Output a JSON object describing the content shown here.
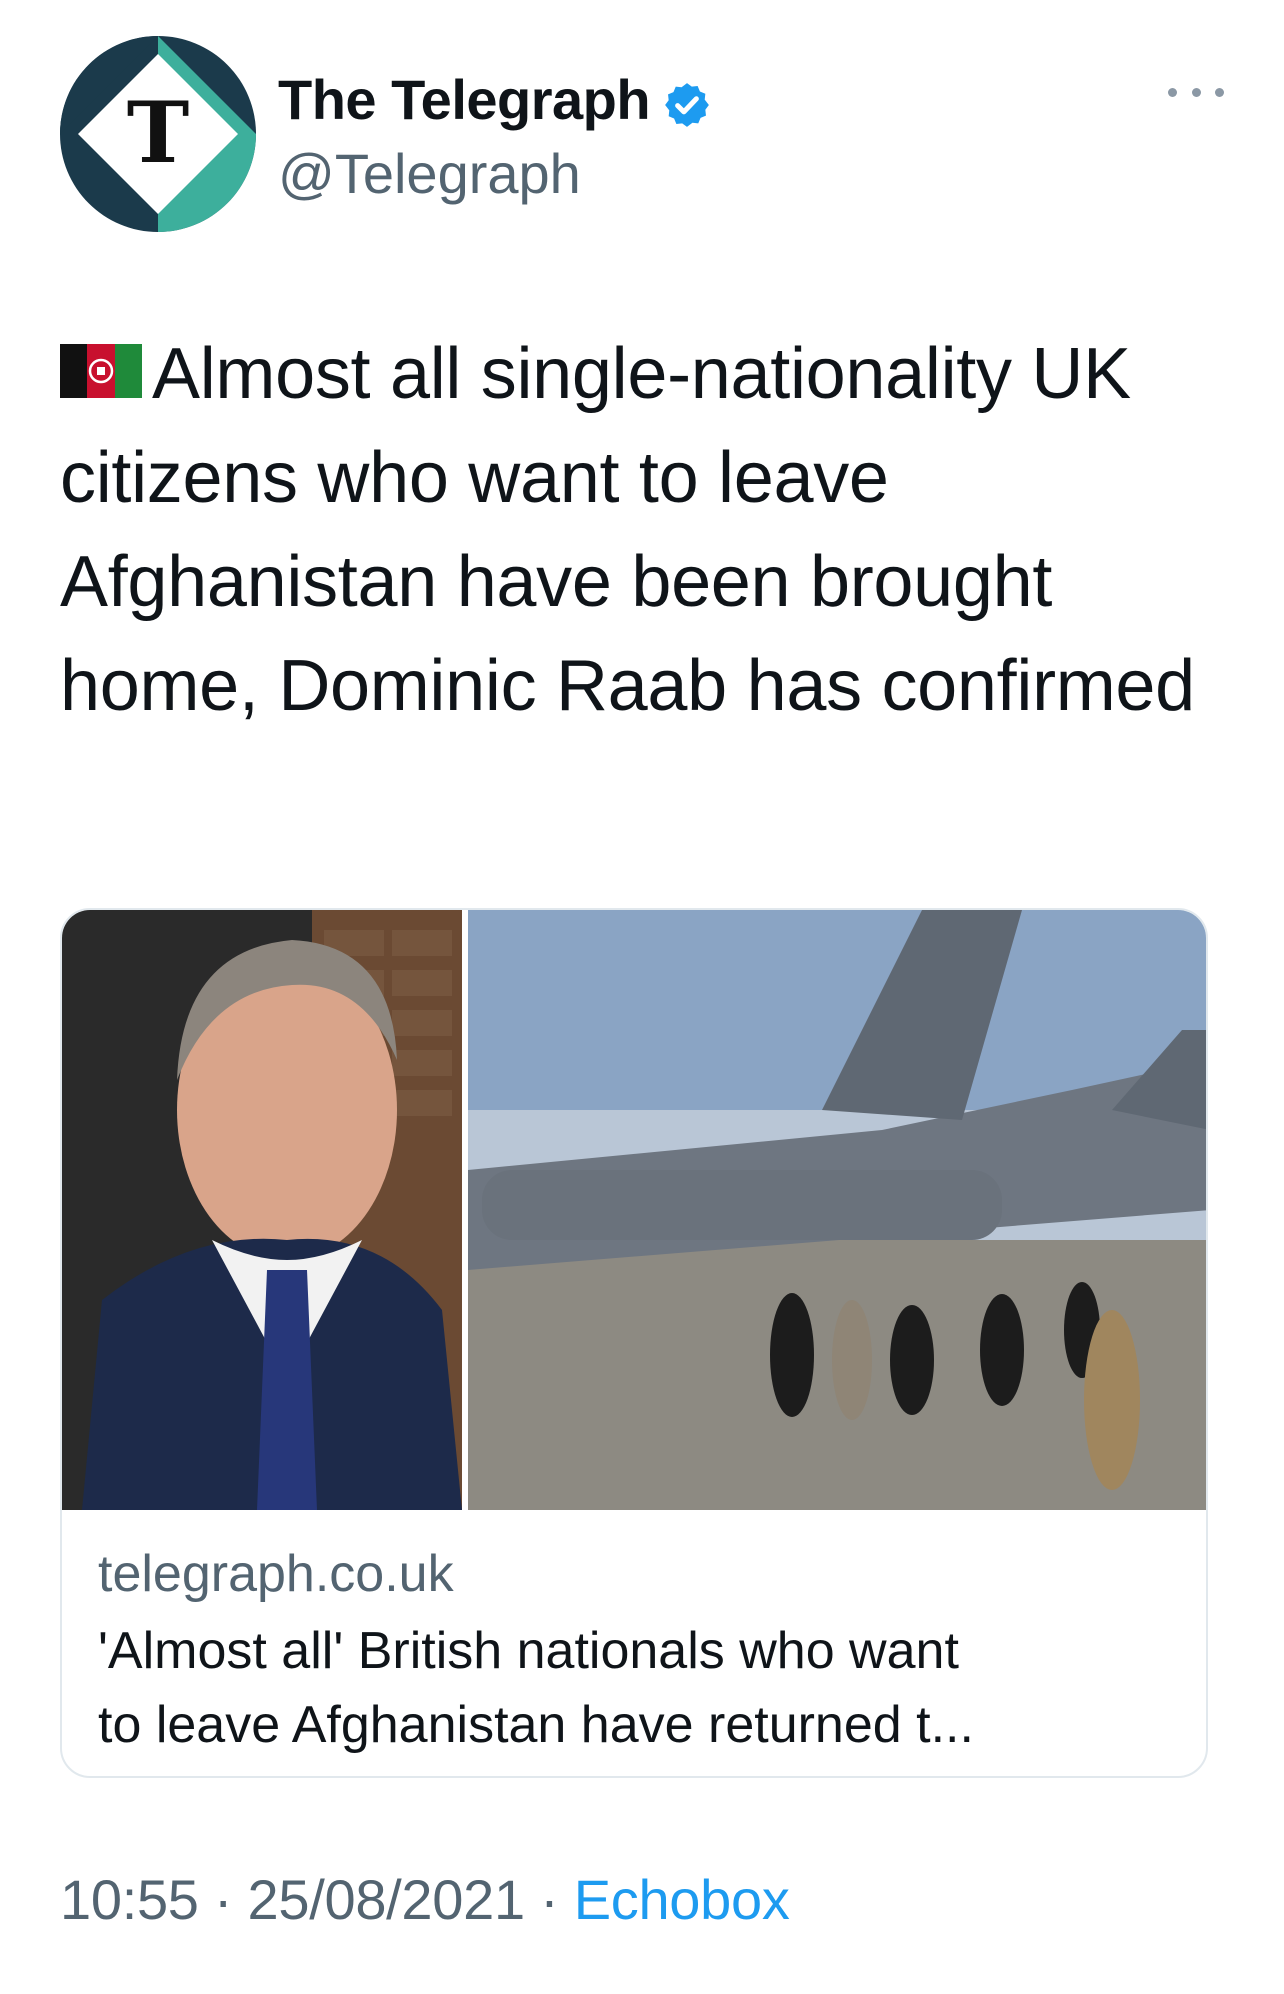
{
  "tweet": {
    "author": {
      "display_name": "The Telegraph",
      "handle": "@Telegraph",
      "verified": true,
      "avatar_letter": "T"
    },
    "flag_icon": "afghanistan-flag-emoji",
    "text": "Almost all single-nationality UK citizens who want to leave Afghanistan have been brought home, Dominic Raab has confirmed",
    "card": {
      "domain": "telegraph.co.uk",
      "title_line1": "'Almost all' British nationals who want",
      "title_line2": "to leave Afghanistan have returned t..."
    },
    "meta": {
      "time": "10:55",
      "separator": "·",
      "date": "25/08/2021",
      "source": "Echobox"
    }
  },
  "colors": {
    "avatar_dark": "#1b3a4b",
    "avatar_teal": "#3fb5a0",
    "verified_blue": "#1d9bf0",
    "link_blue": "#1d9bf0",
    "secondary_text": "#536471"
  }
}
